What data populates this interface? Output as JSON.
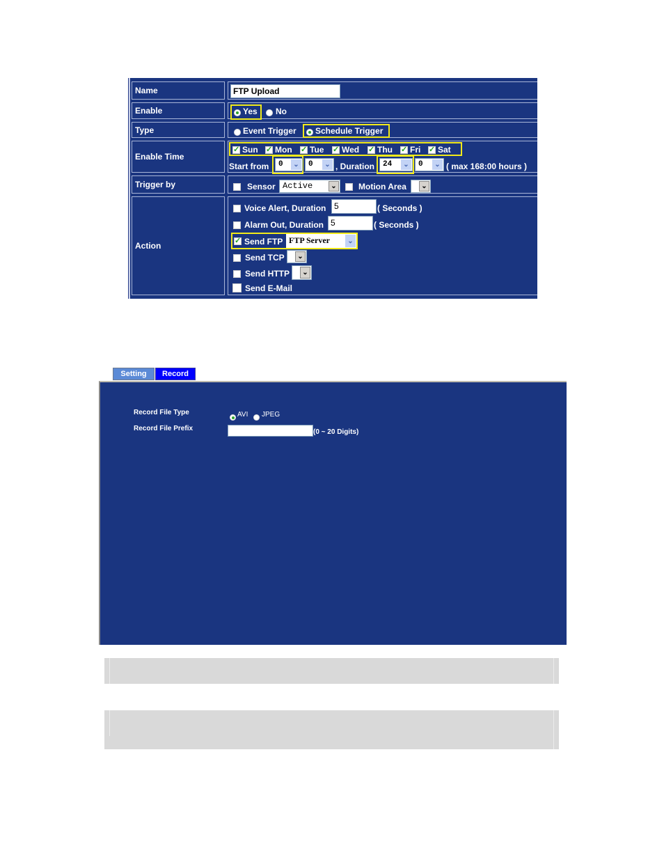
{
  "event_form": {
    "rows": {
      "name": {
        "label": "Name",
        "value": "FTP Upload"
      },
      "enable": {
        "label": "Enable",
        "options": [
          "Yes",
          "No"
        ],
        "selected": "Yes"
      },
      "type": {
        "label": "Type",
        "options": [
          "Event Trigger",
          "Schedule Trigger"
        ],
        "selected": "Schedule Trigger"
      },
      "enable_time": {
        "label": "Enable Time",
        "days": [
          {
            "label": "Sun",
            "checked": true
          },
          {
            "label": "Mon",
            "checked": true
          },
          {
            "label": "Tue",
            "checked": true
          },
          {
            "label": "Wed",
            "checked": true
          },
          {
            "label": "Thu",
            "checked": true
          },
          {
            "label": "Fri",
            "checked": true
          },
          {
            "label": "Sat",
            "checked": true
          }
        ],
        "start_from_label": "Start from",
        "start_hour": "0",
        "start_minute": "0",
        "duration_label": ", Duration",
        "duration_hour": "24",
        "duration_minute": "0",
        "max_note": "( max 168:00 hours )"
      },
      "trigger_by": {
        "label": "Trigger by",
        "sensor_label": "Sensor",
        "sensor_checked": false,
        "sensor_value": "Active",
        "motion_label": "Motion Area",
        "motion_checked": false,
        "motion_value": ""
      },
      "action": {
        "label": "Action",
        "voice_alert": {
          "label": "Voice Alert, Duration",
          "checked": false,
          "value": "5",
          "unit": "( Seconds )"
        },
        "alarm_out": {
          "label": "Alarm Out, Duration",
          "checked": false,
          "value": "5",
          "unit": "( Seconds )"
        },
        "send_ftp": {
          "label": "Send FTP",
          "checked": true,
          "value": "FTP Server"
        },
        "send_tcp": {
          "label": "Send TCP",
          "checked": false,
          "value": ""
        },
        "send_http": {
          "label": "Send HTTP",
          "checked": false,
          "value": ""
        },
        "send_email": {
          "label": "Send E-Mail",
          "checked": false
        }
      }
    }
  },
  "record_page": {
    "tabs": [
      {
        "label": "Setting",
        "active": false
      },
      {
        "label": "Record",
        "active": true
      }
    ],
    "file_type": {
      "label": "Record File Type",
      "options": [
        "AVI",
        "JPEG"
      ],
      "selected": "AVI"
    },
    "file_prefix": {
      "label": "Record File Prefix",
      "value": "",
      "hint": "(0 ~ 20 Digits)"
    }
  },
  "colors": {
    "panel_bg": "#1a3580",
    "highlight": "#f2ea19",
    "tab_active": "#0000ff",
    "tab_inactive": "#5b8ad6",
    "note_bg": "#d9d9d9"
  }
}
